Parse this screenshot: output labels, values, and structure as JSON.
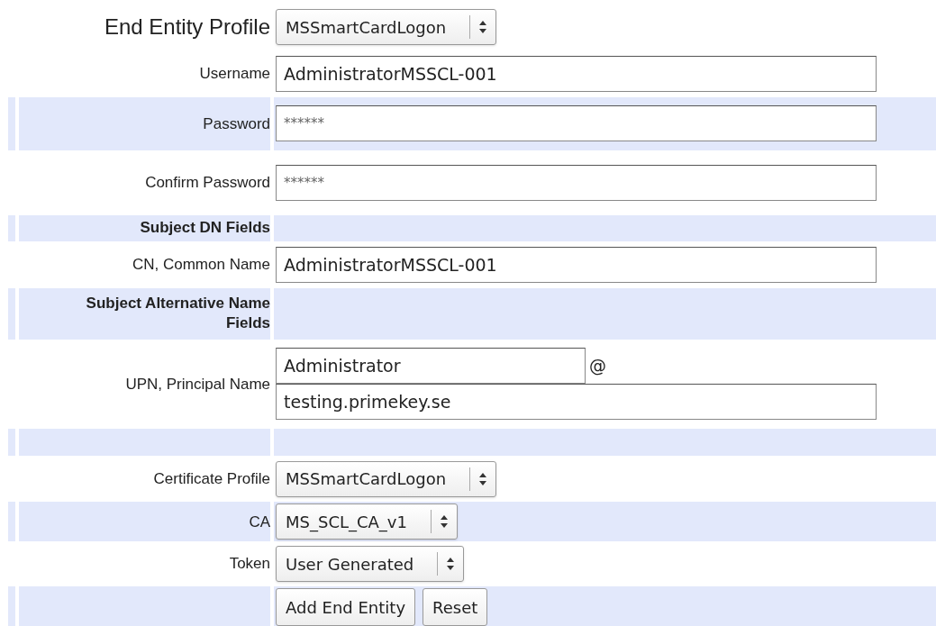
{
  "rows": [
    {
      "kind": "profile",
      "label": "End Entity Profile",
      "value": "MSSmartCardLogon",
      "shaded": false
    },
    {
      "kind": "text",
      "label": "Username",
      "value": "AdministratorMSSCL-001",
      "shaded": false
    },
    {
      "kind": "password",
      "label": "Password",
      "value": "******",
      "shaded": true
    },
    {
      "kind": "password",
      "label": "Confirm Password",
      "value": "******",
      "shaded": false
    },
    {
      "kind": "section",
      "label": "Subject DN Fields",
      "shaded": true
    },
    {
      "kind": "text",
      "label": "CN, Common Name",
      "value": "AdministratorMSSCL-001",
      "shaded": false
    },
    {
      "kind": "section",
      "label": "Subject Alternative Name Fields",
      "shaded": true
    },
    {
      "kind": "upn",
      "label": "UPN, Principal Name",
      "value": "Administrator",
      "separator": "@",
      "domain": "testing.primekey.se",
      "shaded": false
    },
    {
      "kind": "blank",
      "shaded": true
    },
    {
      "kind": "select",
      "label": "Certificate Profile",
      "value": "MSSmartCardLogon",
      "shaded": false
    },
    {
      "kind": "select",
      "label": "CA",
      "value": "MS_SCL_CA_v1",
      "shaded": true
    },
    {
      "kind": "select",
      "label": "Token",
      "value": "User Generated",
      "shaded": false
    },
    {
      "kind": "buttons",
      "buttons": [
        "Add End Entity",
        "Reset"
      ],
      "shaded": true
    }
  ]
}
